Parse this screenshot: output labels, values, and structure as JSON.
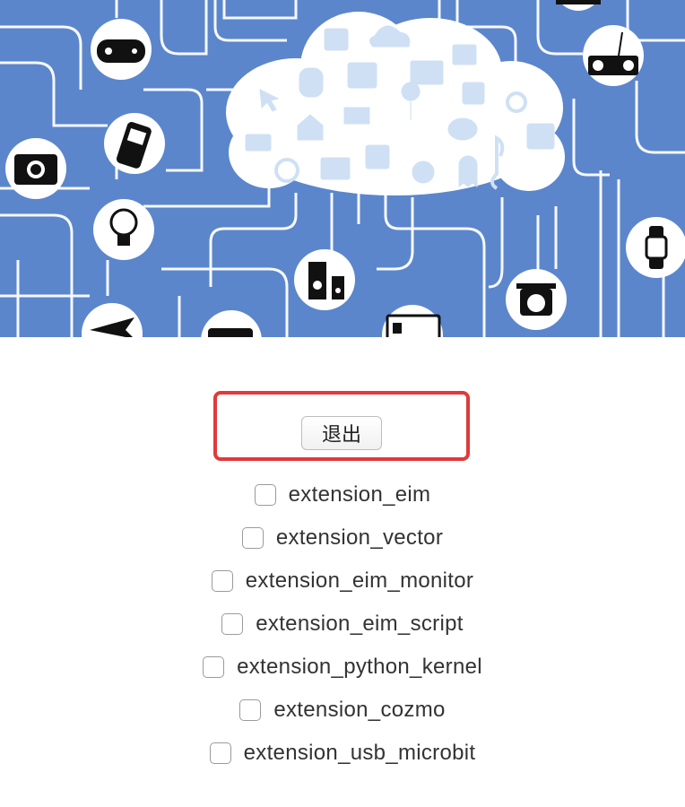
{
  "banner": {
    "background_color": "#5b86cc",
    "icons": [
      "gamepad-icon",
      "mobile-phone-icon",
      "camera-icon",
      "light-bulb-icon",
      "airplane-icon",
      "speaker-icon",
      "printer-icon",
      "kitchen-scale-icon",
      "watch-icon",
      "boombox-icon",
      "cloud-icon"
    ],
    "cloud_icons": [
      "shopping-bag-icon",
      "cloud-download-icon",
      "browser-window-icon",
      "database-icon",
      "touchscreen-icon",
      "monitor-icon",
      "cursor-icon",
      "cart-icon",
      "touch-icon",
      "search-icon",
      "home-icon",
      "map-pin-icon",
      "chat-icon",
      "calendar-icon",
      "mail-icon",
      "chip-icon",
      "clock-icon",
      "chart-monitor-icon",
      "film-icon",
      "ghost-icon",
      "music-note-icon"
    ]
  },
  "logout": {
    "label": "退出",
    "highlight_color": "#e03a3a"
  },
  "extensions": [
    {
      "label": "extension_eim",
      "checked": false
    },
    {
      "label": "extension_vector",
      "checked": false
    },
    {
      "label": "extension_eim_monitor",
      "checked": false
    },
    {
      "label": "extension_eim_script",
      "checked": false
    },
    {
      "label": "extension_python_kernel",
      "checked": false
    },
    {
      "label": "extension_cozmo",
      "checked": false
    },
    {
      "label": "extension_usb_microbit",
      "checked": false
    }
  ]
}
